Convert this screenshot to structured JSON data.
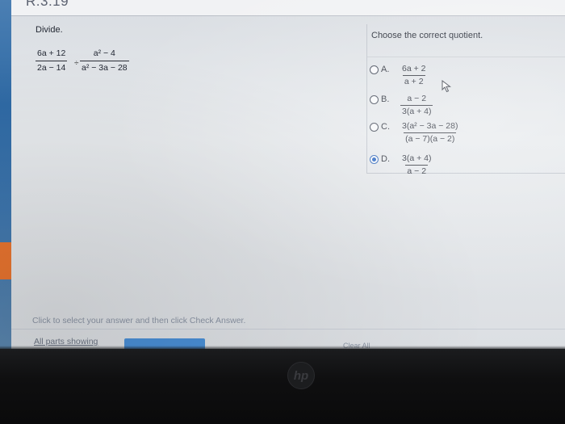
{
  "header": {
    "code": "R.3.19"
  },
  "question": {
    "label": "Divide.",
    "frac1": {
      "num": "6a + 12",
      "den": "2a − 14"
    },
    "operator": "÷",
    "frac2": {
      "num": "a² − 4",
      "den": "a² − 3a − 28"
    }
  },
  "answer_panel": {
    "prompt": "Choose the correct quotient.",
    "options": [
      {
        "letter": "A.",
        "num": "6a + 2",
        "den": "a + 2",
        "selected": false
      },
      {
        "letter": "B.",
        "num": "a − 2",
        "den": "3(a + 4)",
        "selected": false
      },
      {
        "letter": "C.",
        "num": "3(a² − 3a − 28)",
        "den": "(a − 7)(a − 2)",
        "selected": false
      },
      {
        "letter": "D.",
        "num": "3(a + 4)",
        "den": "a − 2",
        "selected": true
      }
    ]
  },
  "instruction": "Click to select your answer and then click Check Answer.",
  "footer": {
    "all_parts": "All parts showing",
    "clear_all": "Clear All"
  },
  "bezel": {
    "logo": "hp"
  },
  "colors": {
    "selected_radio": "#1f5fc0",
    "check_button": "#4a8fd6",
    "side_accent": "#e8742f"
  }
}
